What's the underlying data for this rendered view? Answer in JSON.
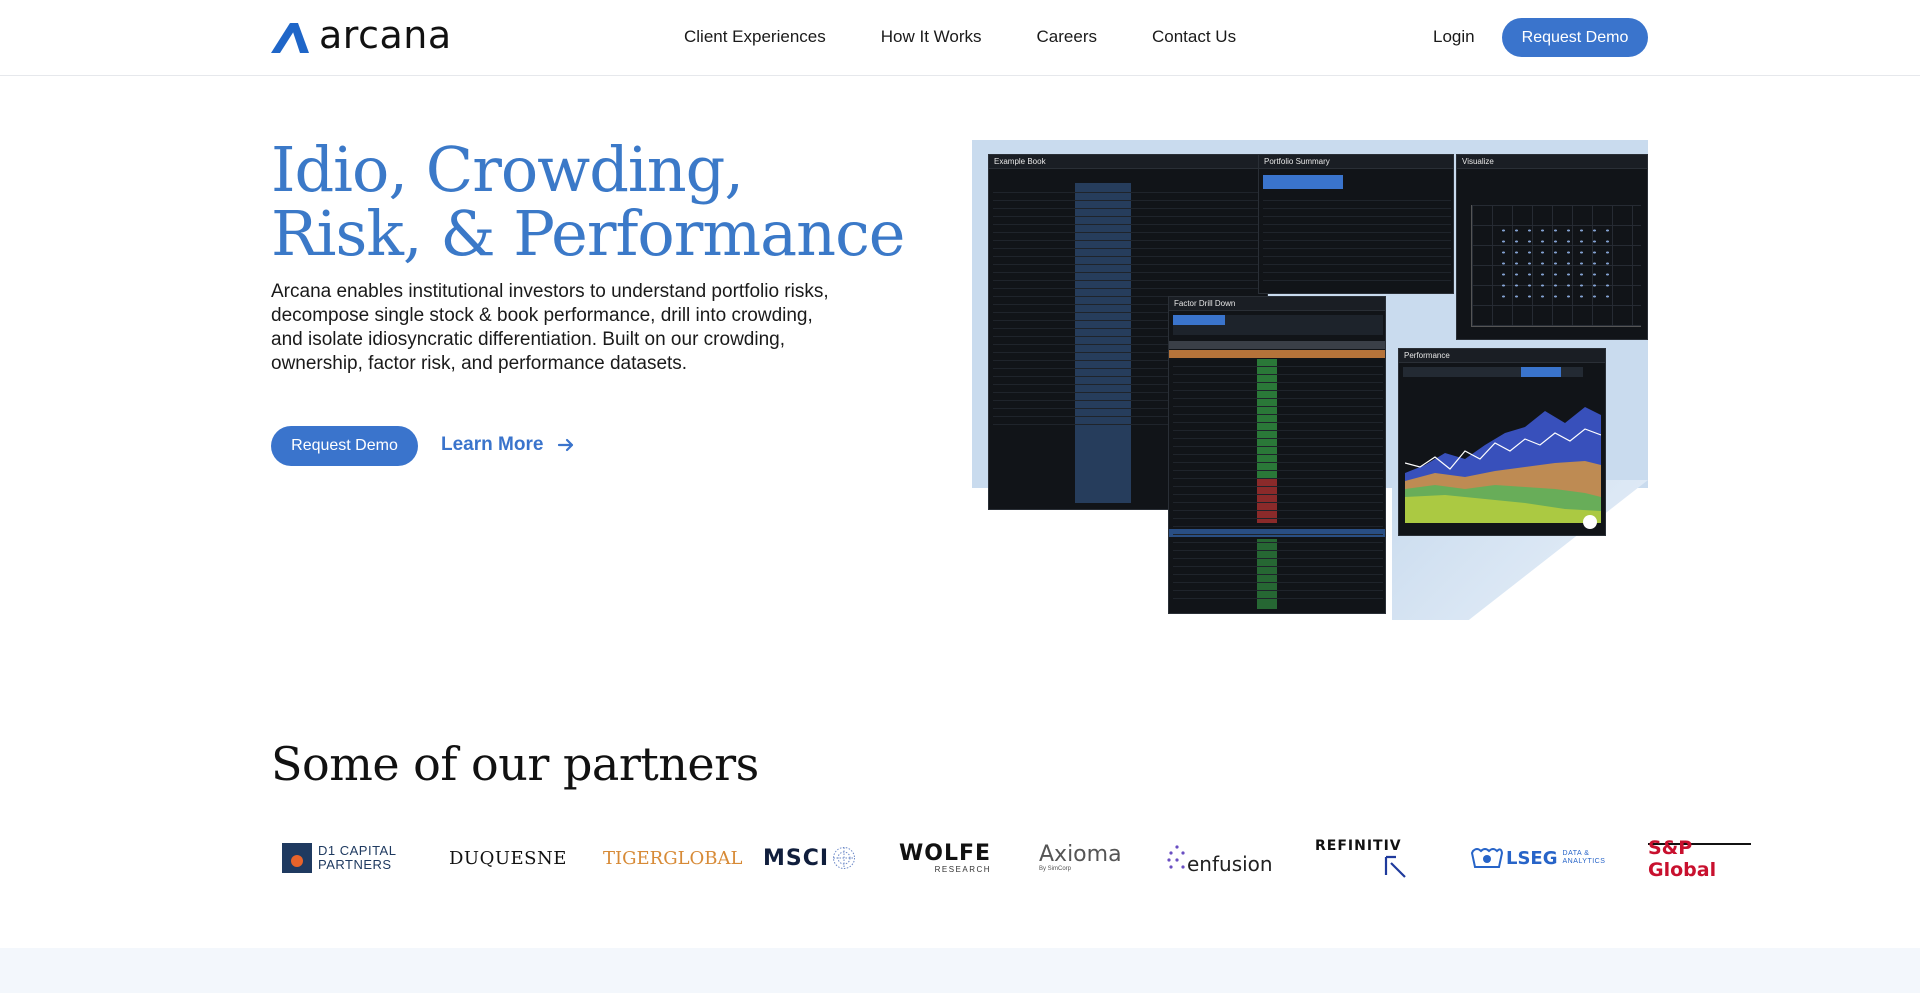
{
  "header": {
    "logo_text": "arcana",
    "nav": [
      "Client Experiences",
      "How It Works",
      "Careers",
      "Contact Us"
    ],
    "login_label": "Login",
    "demo_label": "Request Demo"
  },
  "hero": {
    "title_line1": "Idio, Crowding,",
    "title_line2": "Risk, & Performance",
    "description": "Arcana enables institutional investors to understand portfolio risks, decompose single stock & book performance, drill into crowding, and isolate idiosyncratic differentiation. Built on our crowding, ownership, factor risk, and performance datasets.",
    "demo_label": "Request Demo",
    "learn_more_label": "Learn More"
  },
  "screenshot_panels": {
    "example_book": "Example Book",
    "portfolio_summary": "Portfolio Summary",
    "visualize": "Visualize",
    "factor_drill_down": "Factor Drill Down",
    "performance": "Performance"
  },
  "partners": {
    "title": "Some of our partners",
    "logos": [
      {
        "name": "D1 CAPITAL PARTNERS",
        "line1": "D1 CAPITAL",
        "line2": "PARTNERS"
      },
      {
        "name": "DUQUESNE"
      },
      {
        "name": "TIGERGLOBAL"
      },
      {
        "name": "MSCI"
      },
      {
        "name": "WOLFE RESEARCH",
        "line1": "WOLFE",
        "line2": "RESEARCH"
      },
      {
        "name": "Axioma",
        "sub": "By SimCorp"
      },
      {
        "name": "enfusion"
      },
      {
        "name": "REFINITIV"
      },
      {
        "name": "LSEG DATA & ANALYTICS",
        "line1": "LSEG",
        "line2": "DATA & ANALYTICS"
      },
      {
        "name": "S&P Global"
      }
    ]
  },
  "colors": {
    "brand_blue": "#3a74cc",
    "title_blue": "#3b79c8"
  }
}
